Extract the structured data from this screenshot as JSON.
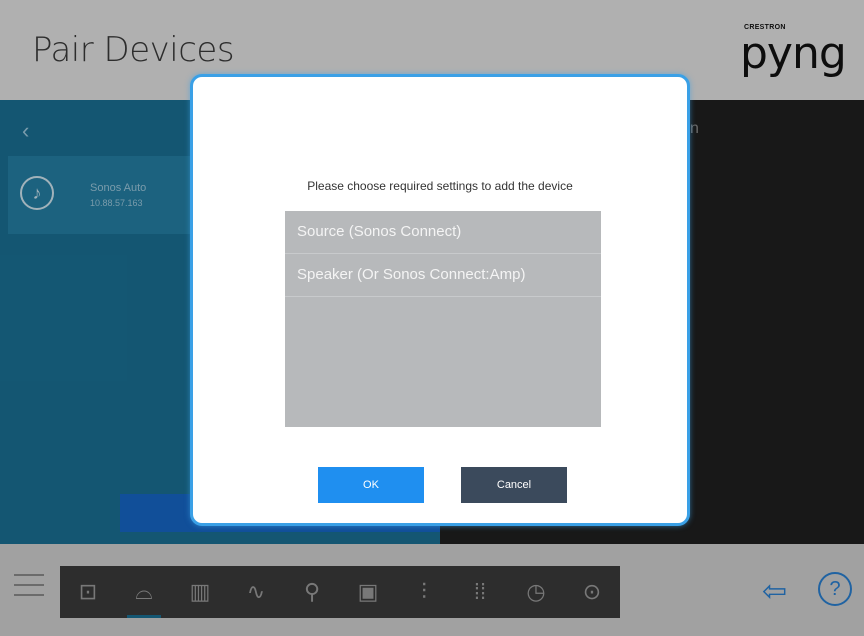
{
  "header": {
    "title": "Pair Devices",
    "brand_small": "CRESTRON",
    "brand_name": "pyng"
  },
  "left_panel": {
    "back_icon": "chevron-left-icon",
    "device": {
      "name": "Sonos Auto",
      "ip": "10.88.57.163",
      "icon": "music-note-icon"
    }
  },
  "right_panel": {
    "partial_text": "n"
  },
  "dialog": {
    "prompt": "Please choose required settings to add the device",
    "options": [
      {
        "label": "Source (Sonos Connect)"
      },
      {
        "label": "Speaker (Or Sonos Connect:Amp)"
      }
    ],
    "ok_label": "OK",
    "cancel_label": "Cancel"
  },
  "toolbar": {
    "items": [
      {
        "icon": "door-icon",
        "glyph": "⊡"
      },
      {
        "icon": "remote-icon",
        "glyph": "⌓"
      },
      {
        "icon": "shades-icon",
        "glyph": "▥"
      },
      {
        "icon": "network-icon",
        "glyph": "∿"
      },
      {
        "icon": "lightbulb-icon",
        "glyph": "⚲"
      },
      {
        "icon": "window-icon",
        "glyph": "▣"
      },
      {
        "icon": "thermometer-icon",
        "glyph": "⫶"
      },
      {
        "icon": "keypad-icon",
        "glyph": "⁞⁞"
      },
      {
        "icon": "clock-icon",
        "glyph": "◷"
      },
      {
        "icon": "temperature-sensor-icon",
        "glyph": "⊙"
      }
    ],
    "active_index": 1
  },
  "colors": {
    "accent": "#1f8ff0",
    "panel": "#1a6f93",
    "cancel": "#3b4a5c"
  }
}
